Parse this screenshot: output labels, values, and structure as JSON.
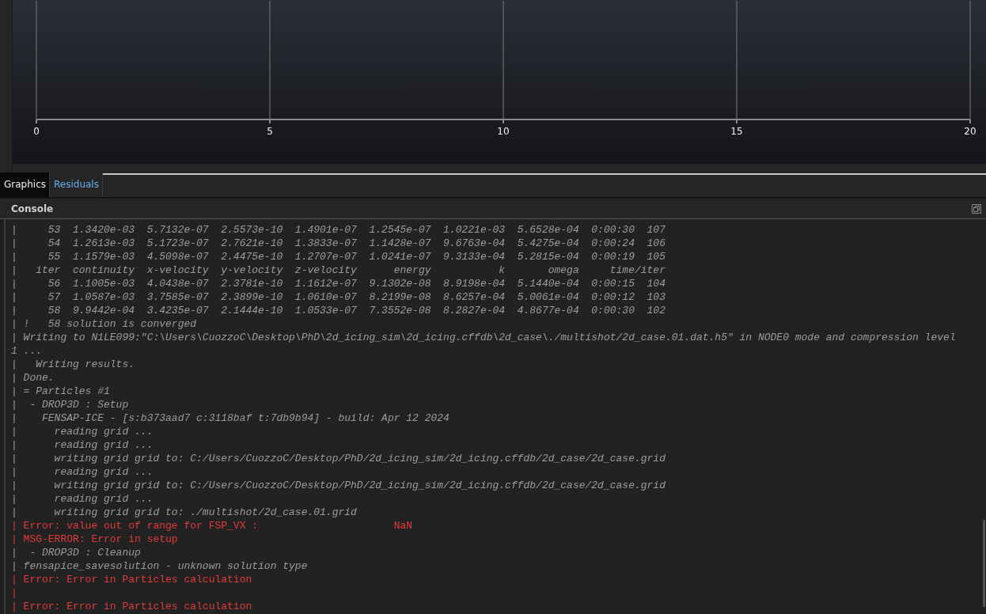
{
  "chart": {
    "x_ticks": [
      "0",
      "5",
      "10",
      "15",
      "20"
    ]
  },
  "tabs": [
    {
      "label": "Graphics",
      "selected": true
    },
    {
      "label": "Residuals",
      "selected": false
    }
  ],
  "console": {
    "title": "Console",
    "lines": [
      {
        "kind": "normal",
        "text": "|     53  1.3420e-03  5.7132e-07  2.5573e-10  1.4901e-07  1.2545e-07  1.0221e-03  5.6528e-04  0:00:30  107"
      },
      {
        "kind": "normal",
        "text": "|     54  1.2613e-03  5.1723e-07  2.7621e-10  1.3833e-07  1.1428e-07  9.6763e-04  5.4275e-04  0:00:24  106"
      },
      {
        "kind": "normal",
        "text": "|     55  1.1579e-03  4.5098e-07  2.4475e-10  1.2707e-07  1.0241e-07  9.3133e-04  5.2815e-04  0:00:19  105"
      },
      {
        "kind": "normal",
        "text": "|   iter  continuity  x-velocity  y-velocity  z-velocity      energy           k       omega     time/iter"
      },
      {
        "kind": "normal",
        "text": "|     56  1.1005e-03  4.0438e-07  2.3781e-10  1.1612e-07  9.1302e-08  8.9198e-04  5.1440e-04  0:00:15  104"
      },
      {
        "kind": "normal",
        "text": "|     57  1.0587e-03  3.7585e-07  2.3899e-10  1.0610e-07  8.2199e-08  8.6257e-04  5.0061e-04  0:00:12  103"
      },
      {
        "kind": "normal",
        "text": "|     58  9.9442e-04  3.4235e-07  2.1444e-10  1.0533e-07  7.3552e-08  8.2827e-04  4.8677e-04  0:00:30  102"
      },
      {
        "kind": "normal",
        "text": "| !   58 solution is converged"
      },
      {
        "kind": "normal",
        "text": "| Writing to N1LE099:\"C:\\Users\\CuozzoC\\Desktop\\PhD\\2d_icing_sim\\2d_icing.cffdb\\2d_case\\./multishot/2d_case.01.dat.h5\" in NODE0 mode and compression level"
      },
      {
        "kind": "normal",
        "text": "1 ..."
      },
      {
        "kind": "normal",
        "text": "|   Writing results."
      },
      {
        "kind": "normal",
        "text": "| Done."
      },
      {
        "kind": "normal",
        "text": "| = Particles #1"
      },
      {
        "kind": "normal",
        "text": "|  - DROP3D : Setup"
      },
      {
        "kind": "normal",
        "text": "|    FENSAP-ICE - [s:b373aad7 c:3118baf t:7db9b94] - build: Apr 12 2024"
      },
      {
        "kind": "normal",
        "text": "|      reading grid ..."
      },
      {
        "kind": "normal",
        "text": "|      reading grid ..."
      },
      {
        "kind": "normal",
        "text": "|      writing grid grid to: C:/Users/CuozzoC/Desktop/PhD/2d_icing_sim/2d_icing.cffdb/2d_case/2d_case.grid"
      },
      {
        "kind": "normal",
        "text": "|      reading grid ..."
      },
      {
        "kind": "normal",
        "text": "|      writing grid grid to: C:/Users/CuozzoC/Desktop/PhD/2d_icing_sim/2d_icing.cffdb/2d_case/2d_case.grid"
      },
      {
        "kind": "normal",
        "text": "|      reading grid ..."
      },
      {
        "kind": "normal",
        "text": "|      writing grid grid to: ./multishot/2d_case.01.grid"
      },
      {
        "kind": "error",
        "text": "| Error: value out of range for FSP_VX :                      NaN"
      },
      {
        "kind": "error",
        "text": "| MSG-ERROR: Error in setup"
      },
      {
        "kind": "normal",
        "text": "|  - DROP3D : Cleanup"
      },
      {
        "kind": "normal",
        "text": "| fensapice_savesolution - unknown solution type"
      },
      {
        "kind": "error",
        "text": "| Error: Error in Particles calculation"
      },
      {
        "kind": "error",
        "text": "|"
      },
      {
        "kind": "error",
        "text": "| Error: Error in Particles calculation"
      }
    ]
  }
}
